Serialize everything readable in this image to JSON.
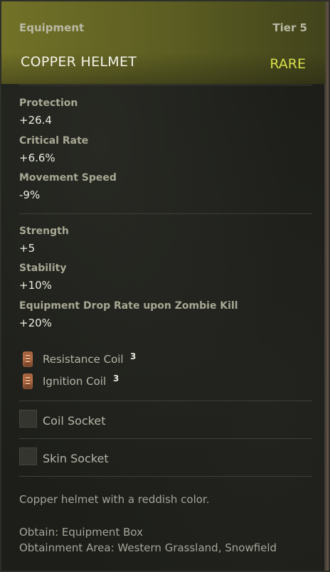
{
  "header": {
    "category": "Equipment",
    "tier": "Tier 5",
    "item_name": "COPPER HELMET",
    "rarity": "RARE",
    "rarity_color": "#d7e04a"
  },
  "base_stats": [
    {
      "label": "Protection",
      "value": "+26.4"
    },
    {
      "label": "Critical Rate",
      "value": "+6.6%"
    },
    {
      "label": "Movement Speed",
      "value": "-9%"
    }
  ],
  "bonus_stats": [
    {
      "label": "Strength",
      "value": "+5"
    },
    {
      "label": "Stability",
      "value": "+10%"
    },
    {
      "label": "Equipment Drop Rate upon Zombie Kill",
      "value": "+20%"
    }
  ],
  "coils": [
    {
      "name": "Resistance Coil",
      "count": "3",
      "icon": "coil-icon"
    },
    {
      "name": "Ignition Coil",
      "count": "3",
      "icon": "coil-icon"
    }
  ],
  "sockets": [
    {
      "label": "Coil Socket"
    },
    {
      "label": "Skin Socket"
    }
  ],
  "description": "Copper helmet with a reddish color.",
  "obtain": "Obtain: Equipment Box",
  "obtain_area": "Obtainment Area: Western Grassland, Snowfield"
}
